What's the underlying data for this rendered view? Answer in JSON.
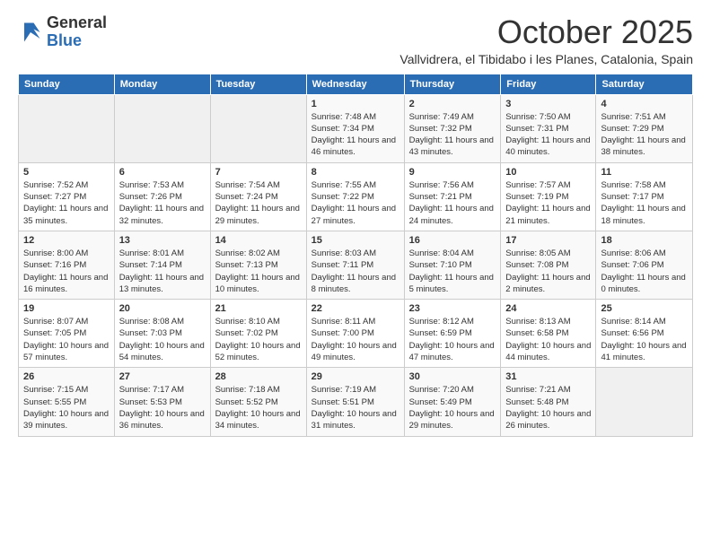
{
  "header": {
    "logo_general": "General",
    "logo_blue": "Blue",
    "month_title": "October 2025",
    "location": "Vallvidrera, el Tibidabo i les Planes, Catalonia, Spain"
  },
  "days_of_week": [
    "Sunday",
    "Monday",
    "Tuesday",
    "Wednesday",
    "Thursday",
    "Friday",
    "Saturday"
  ],
  "weeks": [
    [
      {
        "day": "",
        "info": ""
      },
      {
        "day": "",
        "info": ""
      },
      {
        "day": "",
        "info": ""
      },
      {
        "day": "1",
        "info": "Sunrise: 7:48 AM\nSunset: 7:34 PM\nDaylight: 11 hours and 46 minutes."
      },
      {
        "day": "2",
        "info": "Sunrise: 7:49 AM\nSunset: 7:32 PM\nDaylight: 11 hours and 43 minutes."
      },
      {
        "day": "3",
        "info": "Sunrise: 7:50 AM\nSunset: 7:31 PM\nDaylight: 11 hours and 40 minutes."
      },
      {
        "day": "4",
        "info": "Sunrise: 7:51 AM\nSunset: 7:29 PM\nDaylight: 11 hours and 38 minutes."
      }
    ],
    [
      {
        "day": "5",
        "info": "Sunrise: 7:52 AM\nSunset: 7:27 PM\nDaylight: 11 hours and 35 minutes."
      },
      {
        "day": "6",
        "info": "Sunrise: 7:53 AM\nSunset: 7:26 PM\nDaylight: 11 hours and 32 minutes."
      },
      {
        "day": "7",
        "info": "Sunrise: 7:54 AM\nSunset: 7:24 PM\nDaylight: 11 hours and 29 minutes."
      },
      {
        "day": "8",
        "info": "Sunrise: 7:55 AM\nSunset: 7:22 PM\nDaylight: 11 hours and 27 minutes."
      },
      {
        "day": "9",
        "info": "Sunrise: 7:56 AM\nSunset: 7:21 PM\nDaylight: 11 hours and 24 minutes."
      },
      {
        "day": "10",
        "info": "Sunrise: 7:57 AM\nSunset: 7:19 PM\nDaylight: 11 hours and 21 minutes."
      },
      {
        "day": "11",
        "info": "Sunrise: 7:58 AM\nSunset: 7:17 PM\nDaylight: 11 hours and 18 minutes."
      }
    ],
    [
      {
        "day": "12",
        "info": "Sunrise: 8:00 AM\nSunset: 7:16 PM\nDaylight: 11 hours and 16 minutes."
      },
      {
        "day": "13",
        "info": "Sunrise: 8:01 AM\nSunset: 7:14 PM\nDaylight: 11 hours and 13 minutes."
      },
      {
        "day": "14",
        "info": "Sunrise: 8:02 AM\nSunset: 7:13 PM\nDaylight: 11 hours and 10 minutes."
      },
      {
        "day": "15",
        "info": "Sunrise: 8:03 AM\nSunset: 7:11 PM\nDaylight: 11 hours and 8 minutes."
      },
      {
        "day": "16",
        "info": "Sunrise: 8:04 AM\nSunset: 7:10 PM\nDaylight: 11 hours and 5 minutes."
      },
      {
        "day": "17",
        "info": "Sunrise: 8:05 AM\nSunset: 7:08 PM\nDaylight: 11 hours and 2 minutes."
      },
      {
        "day": "18",
        "info": "Sunrise: 8:06 AM\nSunset: 7:06 PM\nDaylight: 11 hours and 0 minutes."
      }
    ],
    [
      {
        "day": "19",
        "info": "Sunrise: 8:07 AM\nSunset: 7:05 PM\nDaylight: 10 hours and 57 minutes."
      },
      {
        "day": "20",
        "info": "Sunrise: 8:08 AM\nSunset: 7:03 PM\nDaylight: 10 hours and 54 minutes."
      },
      {
        "day": "21",
        "info": "Sunrise: 8:10 AM\nSunset: 7:02 PM\nDaylight: 10 hours and 52 minutes."
      },
      {
        "day": "22",
        "info": "Sunrise: 8:11 AM\nSunset: 7:00 PM\nDaylight: 10 hours and 49 minutes."
      },
      {
        "day": "23",
        "info": "Sunrise: 8:12 AM\nSunset: 6:59 PM\nDaylight: 10 hours and 47 minutes."
      },
      {
        "day": "24",
        "info": "Sunrise: 8:13 AM\nSunset: 6:58 PM\nDaylight: 10 hours and 44 minutes."
      },
      {
        "day": "25",
        "info": "Sunrise: 8:14 AM\nSunset: 6:56 PM\nDaylight: 10 hours and 41 minutes."
      }
    ],
    [
      {
        "day": "26",
        "info": "Sunrise: 7:15 AM\nSunset: 5:55 PM\nDaylight: 10 hours and 39 minutes."
      },
      {
        "day": "27",
        "info": "Sunrise: 7:17 AM\nSunset: 5:53 PM\nDaylight: 10 hours and 36 minutes."
      },
      {
        "day": "28",
        "info": "Sunrise: 7:18 AM\nSunset: 5:52 PM\nDaylight: 10 hours and 34 minutes."
      },
      {
        "day": "29",
        "info": "Sunrise: 7:19 AM\nSunset: 5:51 PM\nDaylight: 10 hours and 31 minutes."
      },
      {
        "day": "30",
        "info": "Sunrise: 7:20 AM\nSunset: 5:49 PM\nDaylight: 10 hours and 29 minutes."
      },
      {
        "day": "31",
        "info": "Sunrise: 7:21 AM\nSunset: 5:48 PM\nDaylight: 10 hours and 26 minutes."
      },
      {
        "day": "",
        "info": ""
      }
    ]
  ]
}
